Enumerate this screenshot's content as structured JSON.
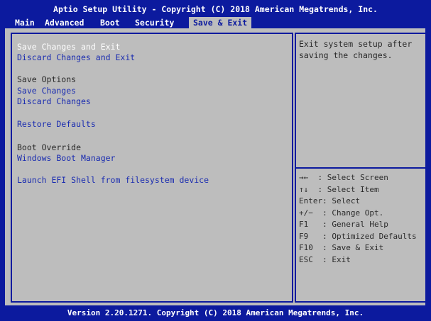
{
  "window": {
    "title": "Aptio Setup Utility - Copyright (C) 2018 American Megatrends, Inc."
  },
  "tabs": [
    {
      "label": "Main"
    },
    {
      "label": "Advanced"
    },
    {
      "label": "Boot"
    },
    {
      "label": "Security"
    },
    {
      "label": "Save & Exit",
      "active": true
    }
  ],
  "menu": {
    "save_changes_and_exit": "Save Changes and Exit",
    "discard_changes_and_exit": "Discard Changes and Exit",
    "save_options_header": "Save Options",
    "save_changes": "Save Changes",
    "discard_changes": "Discard Changes",
    "restore_defaults": "Restore Defaults",
    "boot_override_header": "Boot Override",
    "windows_boot_manager": "Windows Boot Manager",
    "launch_efi_shell": "Launch EFI Shell from filesystem device"
  },
  "help": {
    "text": "Exit system setup after saving the changes.",
    "keys": [
      "→←  : Select Screen",
      "↑↓  : Select Item",
      "Enter: Select",
      "+/−  : Change Opt.",
      "F1   : General Help",
      "F9   : Optimized Defaults",
      "F10  : Save & Exit",
      "ESC  : Exit"
    ]
  },
  "footer": {
    "version": "Version 2.20.1271. Copyright (C) 2018 American Megatrends, Inc."
  },
  "colors": {
    "background": "#0c1a9e",
    "panel": "#bdbdbd",
    "link": "#1a2cb0",
    "text": "#2a2a2a"
  }
}
